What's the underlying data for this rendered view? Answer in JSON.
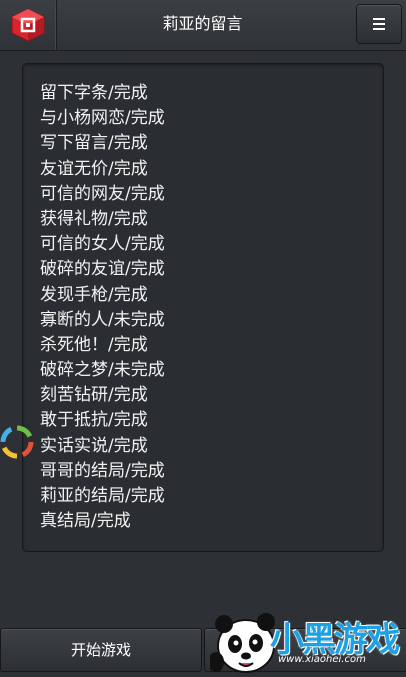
{
  "header": {
    "title": "莉亚的留言",
    "logo_icon": "game-logo-icon",
    "menu_icon": "hamburger-icon"
  },
  "messages": [
    "留下字条/完成",
    "与小杨网恋/完成",
    "写下留言/完成",
    "友谊无价/完成",
    "可信的网友/完成",
    "获得礼物/完成",
    "可信的女人/完成",
    "破碎的友谊/完成",
    "发现手枪/完成",
    "寡断的人/未完成",
    "杀死他！/完成",
    "破碎之梦/未完成",
    "刻苦钻研/完成",
    "敢于抵抗/完成",
    "实话实说/完成",
    "哥哥的结局/完成",
    "莉亚的结局/完成",
    "真结局/完成"
  ],
  "footer": {
    "start_label": "开始游戏",
    "second_label": ""
  },
  "watermark": {
    "brand": "小黑游戏",
    "url": "www.xiaohei.com"
  },
  "colors": {
    "background": "#2d3034",
    "text": "#f2f2f2",
    "logo_red": "#d9232e",
    "watermark_blue": "#1ba1e6"
  }
}
